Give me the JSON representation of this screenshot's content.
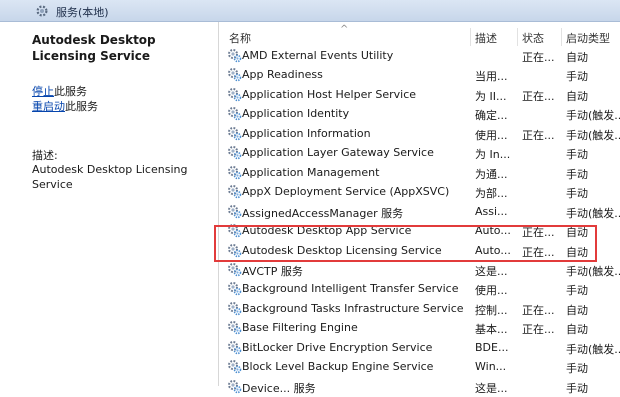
{
  "header": {
    "title": "服务(本地)",
    "icon": "gear-icon"
  },
  "left_pane": {
    "service_title": "Autodesk Desktop Licensing Service",
    "stop_link": "停止",
    "stop_suffix": "此服务",
    "restart_link": "重启动",
    "restart_suffix": "此服务",
    "desc_label": "描述:",
    "description": "Autodesk Desktop Licensing Service"
  },
  "columns": {
    "name": "名称",
    "desc": "描述",
    "status": "状态",
    "startup": "启动类型"
  },
  "services": [
    {
      "name": "AMD External Events Utility",
      "desc": "",
      "status": "正在...",
      "startup": "自动"
    },
    {
      "name": "App Readiness",
      "desc": "当用...",
      "status": "",
      "startup": "手动"
    },
    {
      "name": "Application Host Helper Service",
      "desc": "为 II...",
      "status": "正在...",
      "startup": "自动"
    },
    {
      "name": "Application Identity",
      "desc": "确定...",
      "status": "",
      "startup": "手动(触发..."
    },
    {
      "name": "Application Information",
      "desc": "使用...",
      "status": "正在...",
      "startup": "手动(触发..."
    },
    {
      "name": "Application Layer Gateway Service",
      "desc": "为 In...",
      "status": "",
      "startup": "手动"
    },
    {
      "name": "Application Management",
      "desc": "为通...",
      "status": "",
      "startup": "手动"
    },
    {
      "name": "AppX Deployment Service (AppXSVC)",
      "desc": "为部...",
      "status": "",
      "startup": "手动"
    },
    {
      "name": "AssignedAccessManager 服务",
      "desc": "Assi...",
      "status": "",
      "startup": "手动(触发..."
    },
    {
      "name": "Autodesk Desktop App Service",
      "desc": "Auto...",
      "status": "正在...",
      "startup": "自动"
    },
    {
      "name": "Autodesk Desktop Licensing Service",
      "desc": "Auto...",
      "status": "正在...",
      "startup": "自动"
    },
    {
      "name": "AVCTP 服务",
      "desc": "这是...",
      "status": "",
      "startup": "手动(触发..."
    },
    {
      "name": "Background Intelligent Transfer Service",
      "desc": "使用...",
      "status": "",
      "startup": "手动"
    },
    {
      "name": "Background Tasks Infrastructure Service",
      "desc": "控制...",
      "status": "正在...",
      "startup": "自动"
    },
    {
      "name": "Base Filtering Engine",
      "desc": "基本...",
      "status": "正在...",
      "startup": "自动"
    },
    {
      "name": "BitLocker Drive Encryption Service",
      "desc": "BDE...",
      "status": "",
      "startup": "手动(触发..."
    },
    {
      "name": "Block Level Backup Engine Service",
      "desc": "Win...",
      "status": "",
      "startup": "手动"
    },
    {
      "name": "Device... 服务",
      "desc": "这是...",
      "status": "",
      "startup": "手动"
    }
  ],
  "highlight_color": "#e23b3b",
  "link_color": "#0645ad"
}
